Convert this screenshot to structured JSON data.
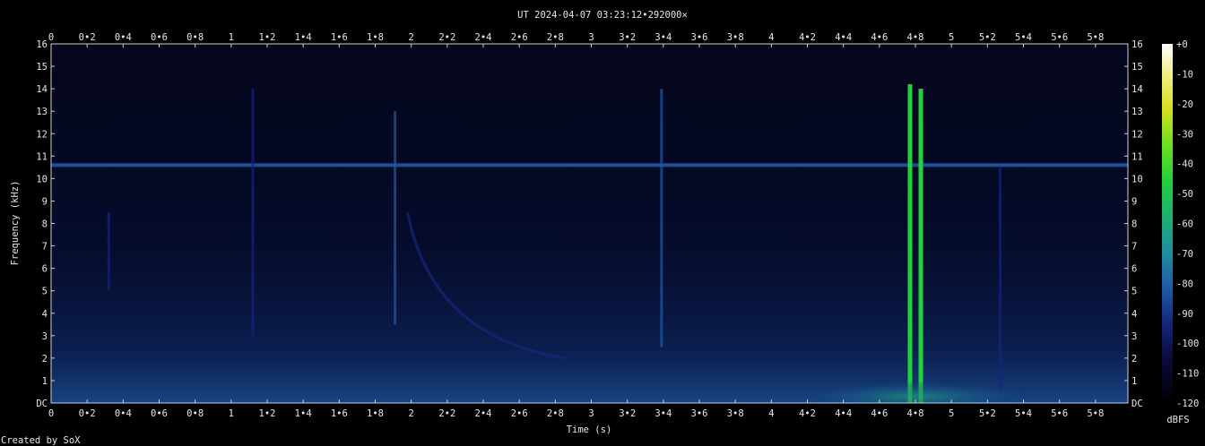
{
  "chart_data": {
    "type": "heatmap",
    "title": "UT 2024-04-07 03:23:12•292000×",
    "xlabel": "Time (s)",
    "ylabel": "Frequency (kHz)",
    "xlim": [
      0,
      5.98
    ],
    "ylim": [
      0,
      16
    ],
    "x_ticks": [
      "0",
      "0•2",
      "0•4",
      "0•6",
      "0•8",
      "1",
      "1•2",
      "1•4",
      "1•6",
      "1•8",
      "2",
      "2•2",
      "2•4",
      "2•6",
      "2•8",
      "3",
      "3•2",
      "3•4",
      "3•6",
      "3•8",
      "4",
      "4•2",
      "4•4",
      "4•6",
      "4•8",
      "5",
      "5•2",
      "5•4",
      "5•6",
      "5•8"
    ],
    "x_tick_values": [
      0,
      0.2,
      0.4,
      0.6,
      0.8,
      1,
      1.2,
      1.4,
      1.6,
      1.8,
      2,
      2.2,
      2.4,
      2.6,
      2.8,
      3,
      3.2,
      3.4,
      3.6,
      3.8,
      4,
      4.2,
      4.4,
      4.6,
      4.8,
      5,
      5.2,
      5.4,
      5.6,
      5.8
    ],
    "y_ticks": [
      "DC",
      "1",
      "2",
      "3",
      "4",
      "5",
      "6",
      "7",
      "8",
      "9",
      "10",
      "11",
      "12",
      "13",
      "14",
      "15",
      "16"
    ],
    "y_tick_values": [
      0,
      1,
      2,
      3,
      4,
      5,
      6,
      7,
      8,
      9,
      10,
      11,
      12,
      13,
      14,
      15,
      16
    ],
    "colorbar": {
      "label": "dBFS",
      "range": [
        -120,
        0
      ],
      "ticks": [
        "+0",
        "-10",
        "-20",
        "-30",
        "-40",
        "-50",
        "-60",
        "-70",
        "-80",
        "-90",
        "-100",
        "-110",
        "-120"
      ],
      "tick_values": [
        0,
        -10,
        -20,
        -30,
        -40,
        -50,
        -60,
        -70,
        -80,
        -90,
        -100,
        -110,
        -120
      ]
    },
    "features": [
      {
        "kind": "horizontal_tone",
        "freq_khz": 10.6,
        "t_start": 0,
        "t_end": 5.98,
        "level_dbfs": -88
      },
      {
        "kind": "vertical_burst",
        "t": 4.77,
        "f_low": 0,
        "f_high": 14.2,
        "level_dbfs": -50
      },
      {
        "kind": "vertical_burst",
        "t": 4.83,
        "f_low": 0,
        "f_high": 14.0,
        "level_dbfs": -55
      },
      {
        "kind": "vertical_burst",
        "t": 1.91,
        "f_low": 3.5,
        "f_high": 13.0,
        "level_dbfs": -88
      },
      {
        "kind": "vertical_burst",
        "t": 3.39,
        "f_low": 2.5,
        "f_high": 14.0,
        "level_dbfs": -90
      },
      {
        "kind": "vertical_burst",
        "t": 1.12,
        "f_low": 3.0,
        "f_high": 14.0,
        "level_dbfs": -95
      },
      {
        "kind": "vertical_burst",
        "t": 0.32,
        "f_low": 5.0,
        "f_high": 8.5,
        "level_dbfs": -95
      },
      {
        "kind": "vertical_burst",
        "t": 5.27,
        "f_low": 0.5,
        "f_high": 10.5,
        "level_dbfs": -95
      },
      {
        "kind": "descending_sweep",
        "t_start": 1.98,
        "f_start": 8.5,
        "t_end": 2.85,
        "f_end": 2.0,
        "level_dbfs": -98
      },
      {
        "kind": "low_band",
        "f_low": 0,
        "f_high": 1.2,
        "t_start": 4.2,
        "t_end": 5.4,
        "level_dbfs": -82
      }
    ]
  },
  "footer": {
    "credit": "Created by SoX"
  }
}
